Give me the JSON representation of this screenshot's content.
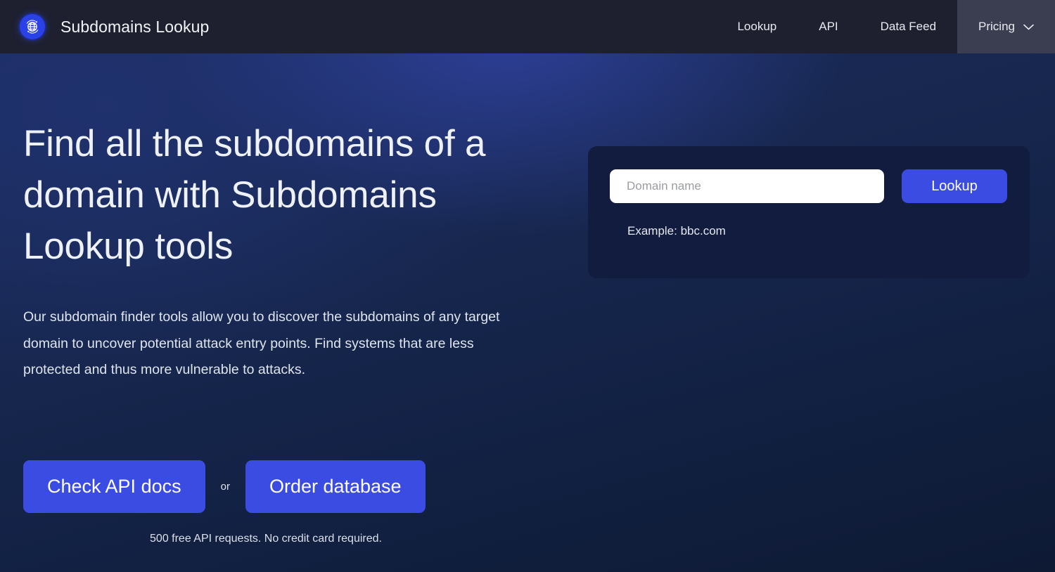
{
  "header": {
    "logo_icon": "globe-network-icon",
    "brand_title": "Subdomains Lookup",
    "nav": [
      {
        "label": "Lookup",
        "active": false
      },
      {
        "label": "API",
        "active": false
      },
      {
        "label": "Data Feed",
        "active": false
      },
      {
        "label": "Pricing",
        "active": true,
        "icon": "chevron-down-icon"
      }
    ]
  },
  "hero": {
    "headline": "Find all the subdomains of a domain with Subdomains Lookup tools",
    "subcopy": "Our subdomain finder tools allow you to discover the subdomains of any target domain to uncover potential attack entry points. Find systems that are less protected and thus more vulnerable to attacks.",
    "cta_primary": "Check API docs",
    "cta_separator": "or",
    "cta_secondary": "Order database",
    "fineprint": "500 free API requests. No credit card required."
  },
  "lookup": {
    "input_value": "",
    "input_placeholder": "Domain name",
    "button_label": "Lookup",
    "example_text": "Example: bbc.com"
  },
  "colors": {
    "header_bg": "#1e2030",
    "nav_active_bg": "#3b3d50",
    "accent_blue": "#3b4ce3",
    "logo_blue": "#2a41e8",
    "card_bg": "#121c3e",
    "hero_top": "#1c2c5e",
    "hero_bottom": "#0e1a34",
    "text_light": "#eef1f7"
  }
}
